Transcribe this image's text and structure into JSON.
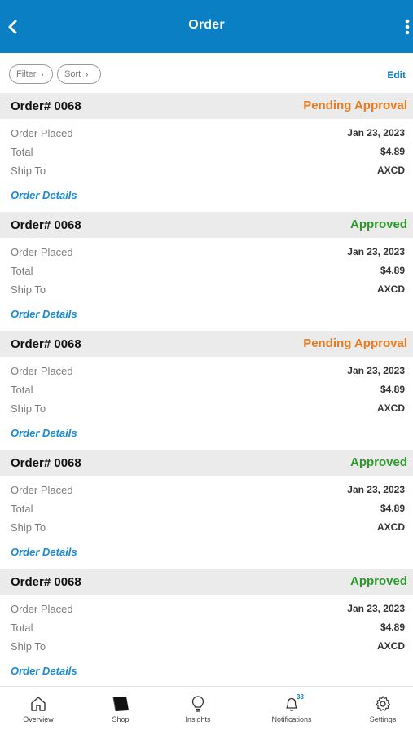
{
  "header": {
    "title": "Order"
  },
  "toolbar": {
    "filter_label": "Filter",
    "sort_label": "Sort",
    "edit_label": "Edit"
  },
  "orders": [
    {
      "id": "Order# 0068",
      "status": "Pending Approval",
      "status_type": "pending",
      "placed_label": "Order Placed",
      "placed": "Jan 23, 2023",
      "total_label": "Total",
      "total": "$4.89",
      "ship_label": "Ship To",
      "ship": "AXCD",
      "details": "Order Details"
    },
    {
      "id": "Order# 0068",
      "status": "Approved",
      "status_type": "approved",
      "placed_label": "Order Placed",
      "placed": "Jan 23, 2023",
      "total_label": "Total",
      "total": "$4.89",
      "ship_label": "Ship To",
      "ship": "AXCD",
      "details": "Order Details"
    },
    {
      "id": "Order# 0068",
      "status": "Pending Approval",
      "status_type": "pending",
      "placed_label": "Order Placed",
      "placed": "Jan 23, 2023",
      "total_label": "Total",
      "total": "$4.89",
      "ship_label": "Ship To",
      "ship": "AXCD",
      "details": "Order Details"
    },
    {
      "id": "Order# 0068",
      "status": "Approved",
      "status_type": "approved",
      "placed_label": "Order Placed",
      "placed": "Jan 23, 2023",
      "total_label": "Total",
      "total": "$4.89",
      "ship_label": "Ship To",
      "ship": "AXCD",
      "details": "Order Details"
    },
    {
      "id": "Order# 0068",
      "status": "Approved",
      "status_type": "approved",
      "placed_label": "Order Placed",
      "placed": "Jan 23, 2023",
      "total_label": "Total",
      "total": "$4.89",
      "ship_label": "Ship To",
      "ship": "AXCD",
      "details": "Order Details"
    }
  ],
  "tabs": [
    {
      "label": "Overview",
      "icon": "home-icon"
    },
    {
      "label": "Shop",
      "icon": "shop-icon"
    },
    {
      "label": "Insights",
      "icon": "lightbulb-icon"
    },
    {
      "label": "Notifications",
      "icon": "bell-icon",
      "badge": "33"
    },
    {
      "label": "Settings",
      "icon": "gear-icon"
    }
  ],
  "colors": {
    "brand": "#0a7fc4",
    "pending": "#ea7a1e",
    "approved": "#2b9a2b",
    "link": "#1a8ad1"
  }
}
